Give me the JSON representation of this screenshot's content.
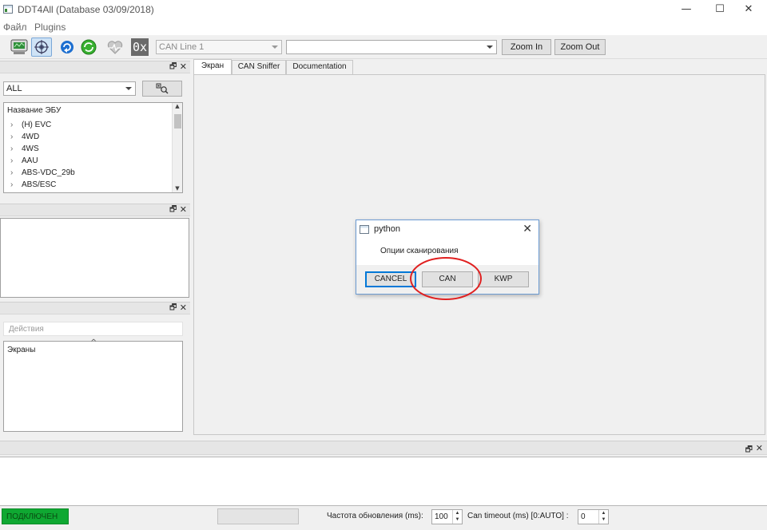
{
  "window": {
    "title": "DDT4All (Database 03/09/2018)",
    "minimize": "—",
    "maximize": "☐",
    "close": "✕"
  },
  "menu": [
    "Файл",
    "Plugins"
  ],
  "toolbar": {
    "can_line": "CAN Line 1",
    "second_combo": "",
    "zoom_in": "Zoom In",
    "zoom_out": "Zoom Out",
    "hex_label": "0x"
  },
  "ecu_panel": {
    "filter_value": "ALL",
    "header": "Название ЭБУ",
    "items": [
      "(H) EVC",
      "4WD",
      "4WS",
      "AAU",
      "ABS-VDC_29b",
      "ABS/ESC"
    ]
  },
  "actions_panel": {
    "placeholder": "Действия",
    "screens_label": "Экраны",
    "caret": "^"
  },
  "tabs": [
    "Экран",
    "CAN Sniffer",
    "Documentation"
  ],
  "dialog": {
    "title": "python",
    "message": "Опции сканирования",
    "buttons": [
      "CANCEL",
      "CAN",
      "KWP"
    ],
    "close": "✕"
  },
  "statusbar": {
    "connection": "ПОДКЛЮЧЕН",
    "refresh_label": "Частота обновления (ms):",
    "refresh_value": "100",
    "timeout_label": "Can timeout (ms) [0:AUTO] :",
    "timeout_value": "0"
  },
  "colors": {
    "connected": "#0fa832",
    "annotation": "#e02020",
    "dialog_border": "#6c9bd2"
  }
}
